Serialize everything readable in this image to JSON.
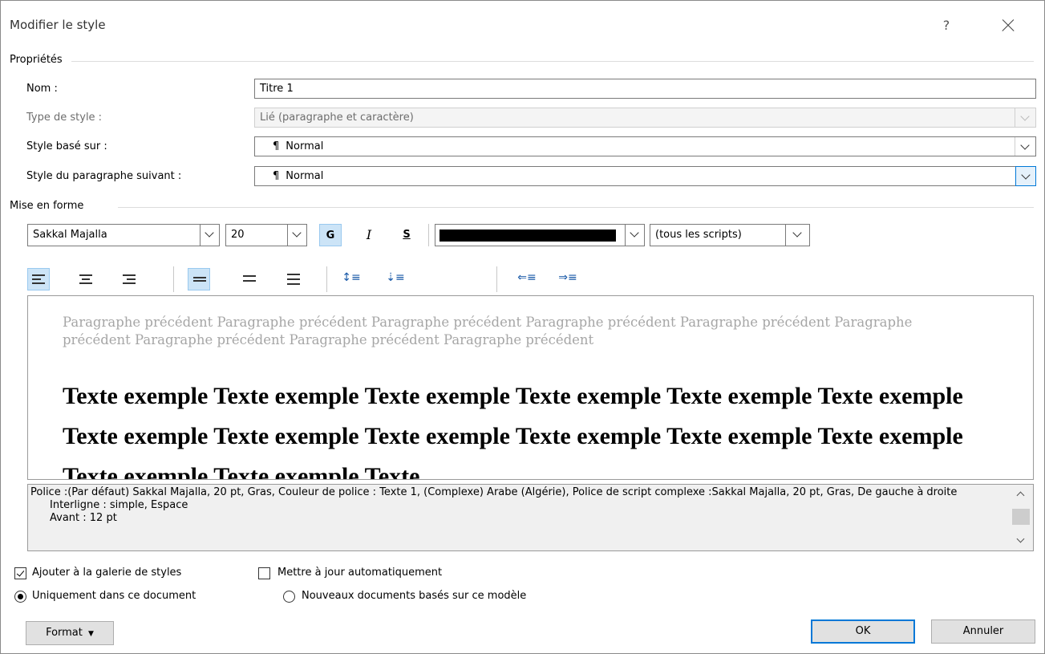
{
  "window": {
    "title": "Modifier le style",
    "help": "?"
  },
  "properties": {
    "group_label": "Propriétés",
    "name_label": "Nom :",
    "name_value": "Titre 1",
    "type_label": "Type de style :",
    "type_value": "Lié (paragraphe et caractère)",
    "based_on_label": "Style basé sur :",
    "based_on_value": "Normal",
    "next_label": "Style du paragraphe suivant :",
    "next_value": "Normal",
    "para_glyph": "¶"
  },
  "formatting": {
    "group_label": "Mise en forme",
    "font": "Sakkal Majalla",
    "size": "20",
    "bold": "G",
    "italic": "I",
    "underline": "S",
    "font_color": "#000000",
    "scripts": "(tous les scripts)"
  },
  "preview": {
    "previous_paragraph": "Paragraphe précédent Paragraphe précédent Paragraphe précédent Paragraphe précédent Paragraphe précédent Paragraphe précédent Paragraphe précédent Paragraphe précédent Paragraphe précédent",
    "sample_text": "Texte exemple Texte exemple Texte exemple Texte exemple Texte exemple Texte exemple Texte exemple Texte exemple Texte exemple Texte exemple Texte exemple Texte exemple Texte exemple Texte exemple Texte"
  },
  "description": {
    "line1": "Police :(Par défaut) Sakkal Majalla, 20 pt, Gras, Couleur de police : Texte 1, (Complexe) Arabe (Algérie), Police de script complexe :Sakkal Majalla, 20 pt, Gras, De gauche à droite",
    "line2": "Interligne : simple, Espace",
    "line3": "Avant : 12 pt"
  },
  "options": {
    "add_gallery": "Ajouter à la galerie de styles",
    "auto_update": "Mettre à jour automatiquement",
    "only_document": "Uniquement dans ce document",
    "new_documents": "Nouveaux documents basés sur ce modèle"
  },
  "buttons": {
    "format": "Format",
    "ok": "OK",
    "cancel": "Annuler"
  }
}
